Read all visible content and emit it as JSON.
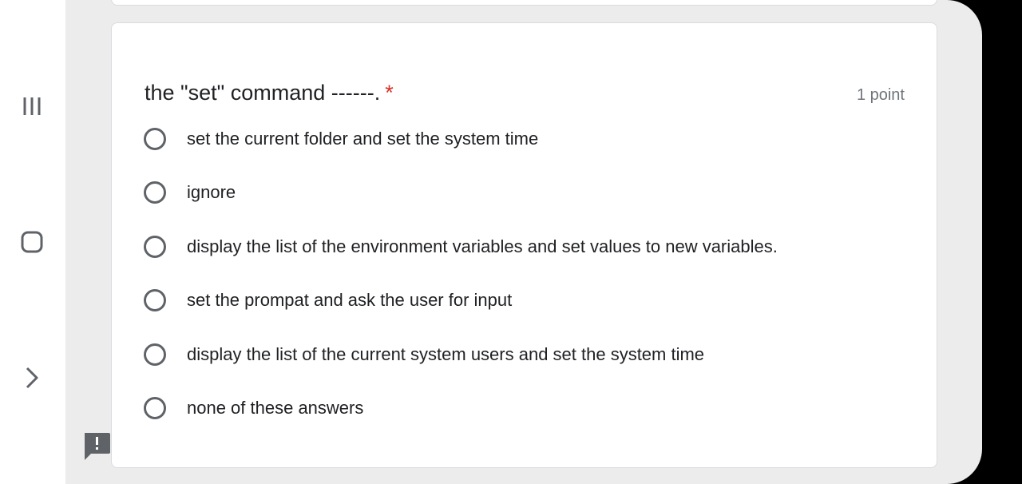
{
  "question": {
    "title": "the \"set\" command ------.",
    "required_marker": "*",
    "points": "1 point",
    "options": [
      {
        "label": "set the current folder and set the system time",
        "selected": false
      },
      {
        "label": "ignore",
        "selected": false
      },
      {
        "label": "display the list of the environment variables and set values to new variables.",
        "selected": false
      },
      {
        "label": "set the prompat and ask the user for input",
        "selected": false
      },
      {
        "label": "display the list of the current system users and set the system time",
        "selected": false
      },
      {
        "label": "none of these answers",
        "selected": false
      }
    ]
  },
  "icons": {
    "nav_recents": "recents-icon",
    "nav_home": "home-icon",
    "nav_back": "back-chevron-icon",
    "report": "report-problem-icon"
  },
  "colors": {
    "required": "#d93025",
    "text": "#202124",
    "muted": "#70757a",
    "radio_border": "#5f6368",
    "background": "#ececec"
  }
}
